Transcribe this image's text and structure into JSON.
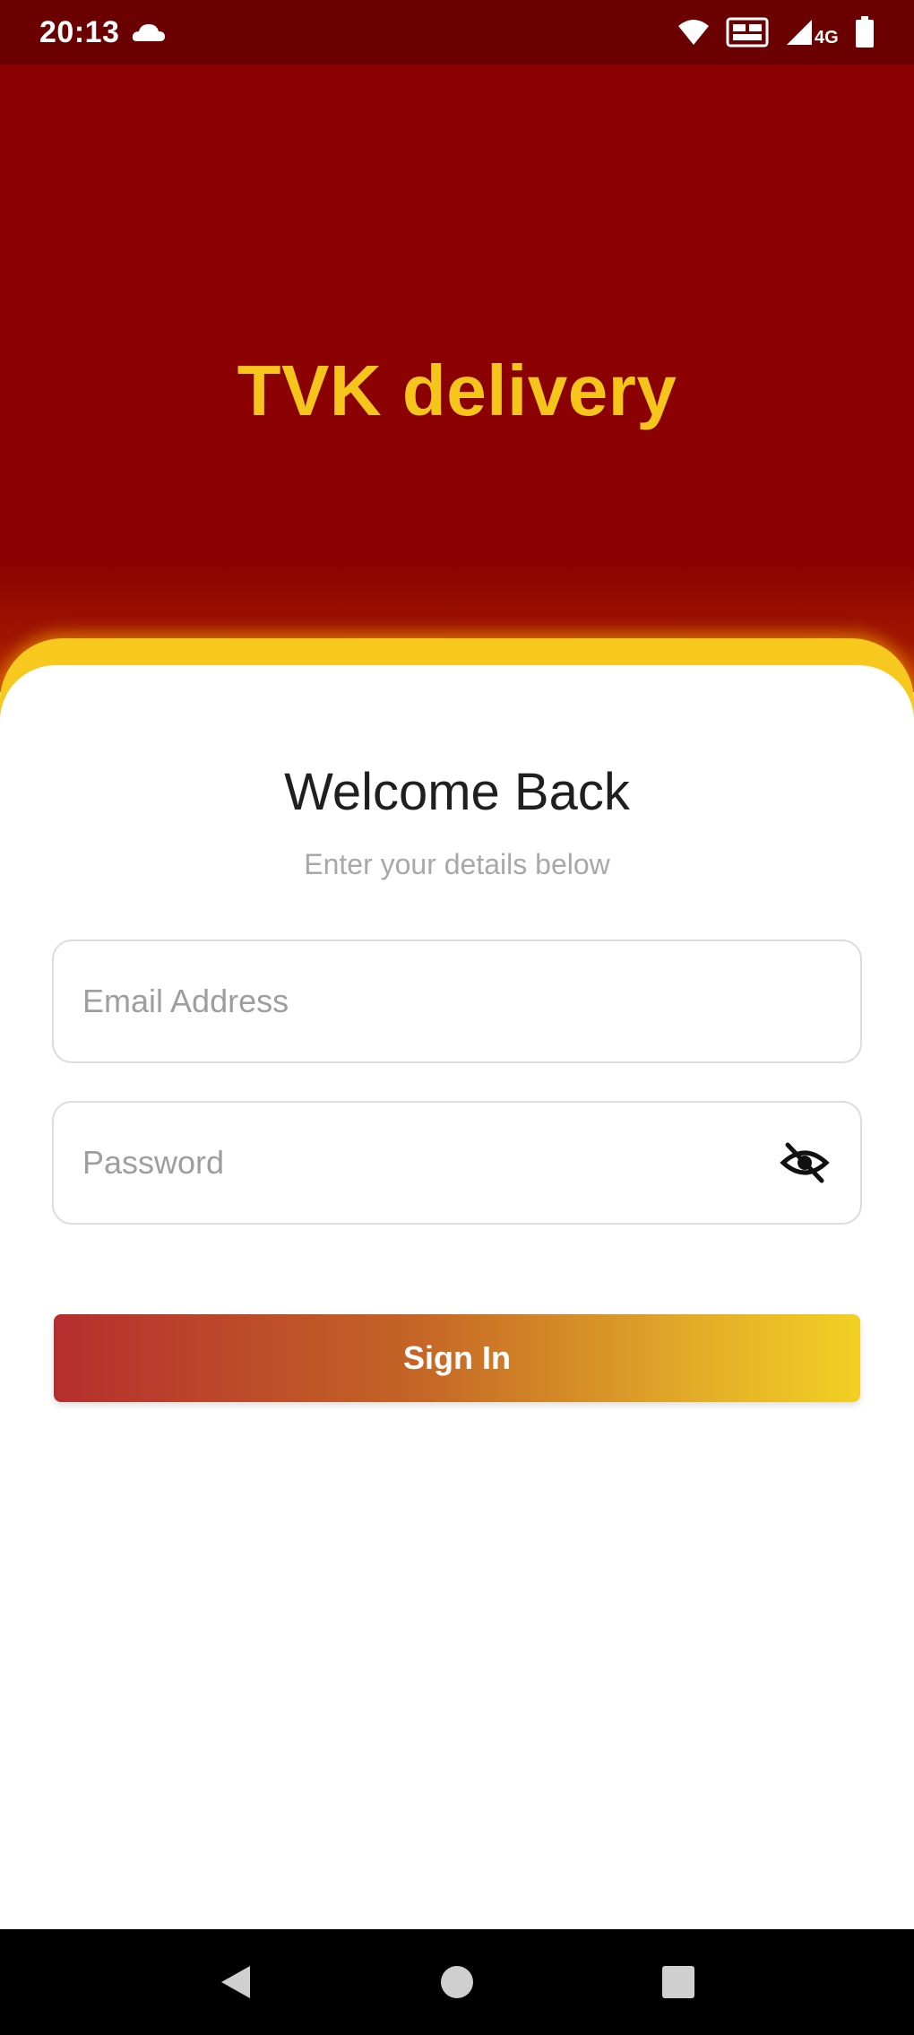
{
  "status_bar": {
    "time": "20:13",
    "icons": [
      "cloud-icon",
      "wifi-icon",
      "sim-card-icon",
      "signal-icon",
      "battery-icon"
    ]
  },
  "header": {
    "app_title": "TVK delivery"
  },
  "login": {
    "welcome_title": "Welcome Back",
    "subtitle": "Enter your details below",
    "email": {
      "value": "",
      "placeholder": "Email Address"
    },
    "password": {
      "value": "",
      "placeholder": "Password",
      "toggle_icon": "eye-off-icon"
    },
    "sign_in_label": "Sign In"
  },
  "navigation": {
    "icons": [
      "back-icon",
      "home-icon",
      "recents-icon"
    ]
  },
  "colors": {
    "header_background": "#8b0000",
    "status_bar_background": "#6a0000",
    "title_yellow": "#f5c51c",
    "card_rim": "#f7c81e",
    "button_gradient_start": "#b52e2e",
    "button_gradient_end": "#f2d023"
  }
}
